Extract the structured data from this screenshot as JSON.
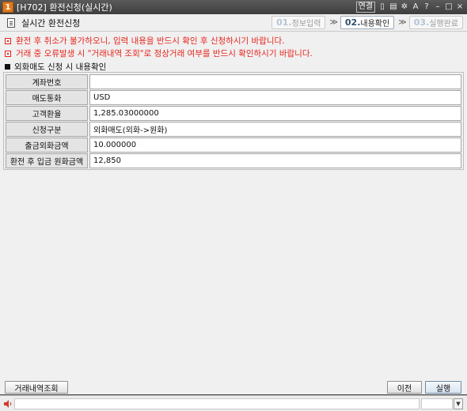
{
  "window": {
    "number": "1",
    "title": "[H702] 환전신청(실시간)",
    "badge": "연결",
    "controls": [
      "pin-icon",
      "tray-icon",
      "gear-icon",
      "font-icon",
      "help-icon",
      "minimize-icon",
      "maximize-icon",
      "close-icon"
    ]
  },
  "header": {
    "title": "실시간 환전신청",
    "steps": [
      {
        "num": "01.",
        "label": "정보입력"
      },
      {
        "num": "02.",
        "label": "내용확인"
      },
      {
        "num": "03.",
        "label": "실행완료"
      }
    ],
    "separator": "≫"
  },
  "notices": [
    "환전 후 취소가 불가하오니, 입력 내용을 반드시 확인 후 신청하시기 바랍니다.",
    "거래 중 오류발생 시 \"거래내역 조회\"로 정상거래 여부를 반드시 확인하시기 바랍니다."
  ],
  "section_title": "외화매도 신청 시 내용확인",
  "form": {
    "rows": [
      {
        "label": "계좌번호",
        "value": ""
      },
      {
        "label": "매도통화",
        "value": "USD"
      },
      {
        "label": "고객환율",
        "value": "1,285.03000000"
      },
      {
        "label": "신청구분",
        "value": "외화매도(외화->원화)"
      },
      {
        "label": "출금외화금액",
        "value": "10.000000"
      },
      {
        "label": "환전 후 입금 원화금액",
        "value": "12,850"
      }
    ]
  },
  "footer": {
    "history_button": "거래내역조회",
    "prev_button": "이전",
    "execute_button": "실행"
  },
  "colors": {
    "notice_red": "#e8251d",
    "titlebar": "#3e3e3e",
    "step_active_num": "#2f4f70",
    "window_badge": "#e07a1a"
  }
}
